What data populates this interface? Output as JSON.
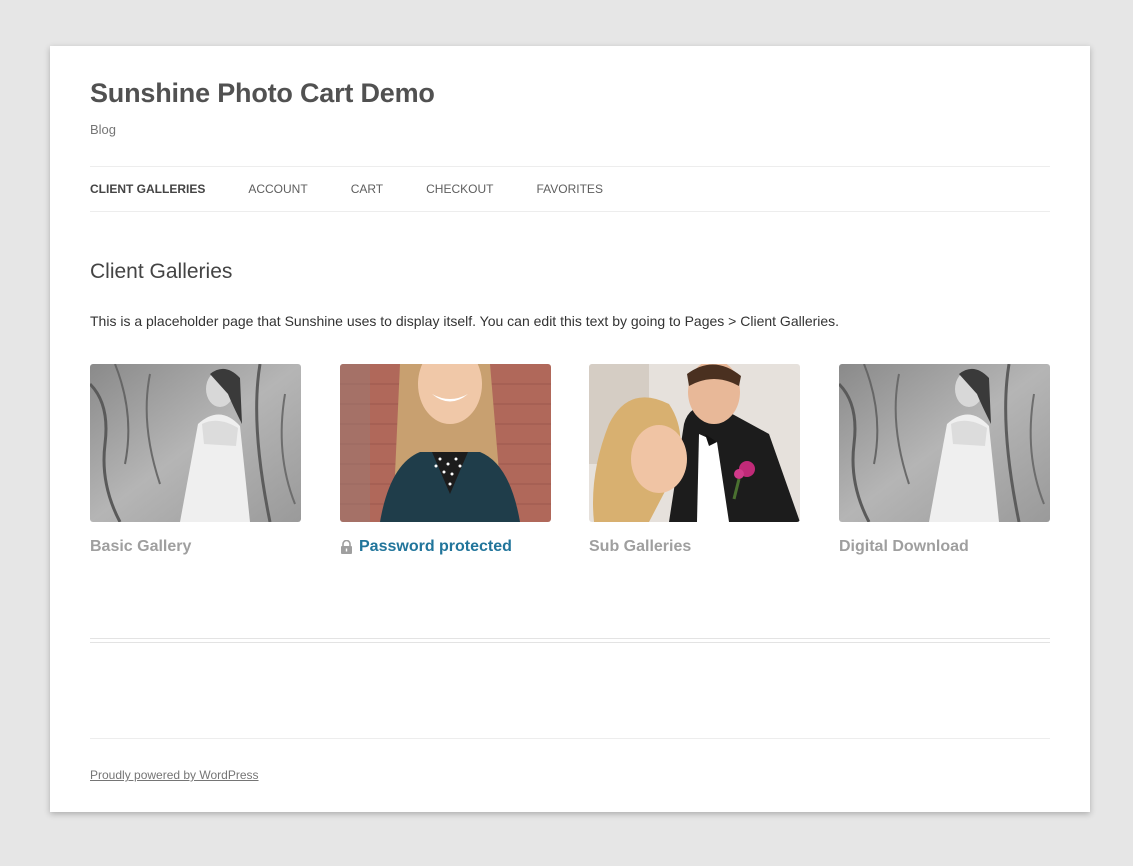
{
  "site": {
    "title": "Sunshine Photo Cart Demo",
    "description": "Blog"
  },
  "nav": {
    "items": [
      {
        "label": "CLIENT GALLERIES",
        "current": true
      },
      {
        "label": "ACCOUNT",
        "current": false
      },
      {
        "label": "CART",
        "current": false
      },
      {
        "label": "CHECKOUT",
        "current": false
      },
      {
        "label": "FAVORITES",
        "current": false
      }
    ]
  },
  "content": {
    "title": "Client Galleries",
    "text": "This is a placeholder page that Sunshine uses to display itself. You can edit this text by going to Pages > Client Galleries."
  },
  "galleries": [
    {
      "title": "Basic Gallery",
      "image": "bw-bride-photo",
      "locked": false
    },
    {
      "title": "Password protected",
      "image": "smiling-woman-photo",
      "locked": true
    },
    {
      "title": "Sub Galleries",
      "image": "wedding-couple-photo",
      "locked": false
    },
    {
      "title": "Digital Download",
      "image": "bw-bride-photo",
      "locked": false
    }
  ],
  "footer": {
    "credit": "Proudly powered by WordPress"
  },
  "colors": {
    "background": "#e6e6e6",
    "link_active": "#21759b",
    "gallery_label": "#9f9f9f"
  }
}
